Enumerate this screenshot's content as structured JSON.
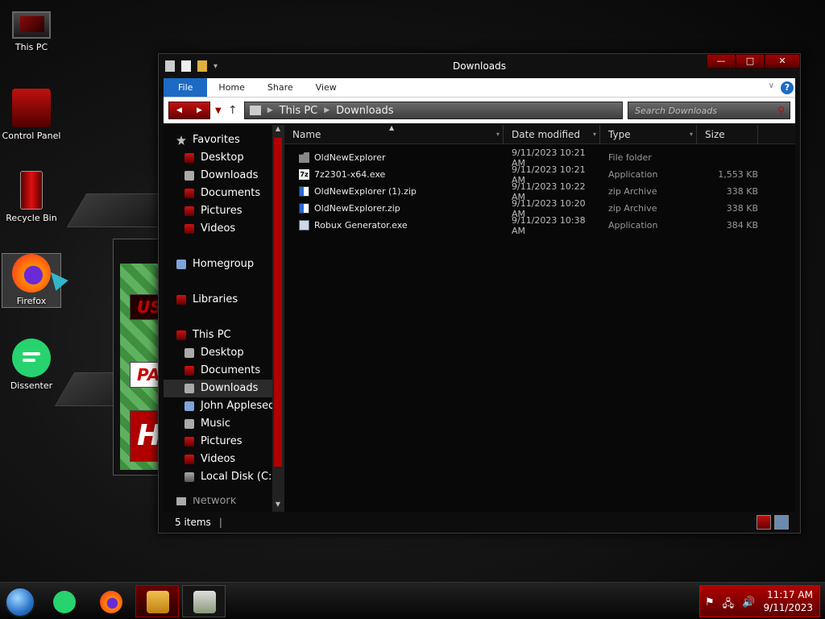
{
  "desktop": {
    "icons": [
      {
        "label": "This PC",
        "icon": "this-pc-icon"
      },
      {
        "label": "Control Panel",
        "icon": "control-panel-icon"
      },
      {
        "label": "Recycle Bin",
        "icon": "recycle-bin-icon"
      },
      {
        "label": "Firefox",
        "icon": "firefox-icon"
      },
      {
        "label": "Dissenter",
        "icon": "dissenter-icon"
      }
    ],
    "bg_window": {
      "banner1": "US",
      "banner2": "PA",
      "banner3": "H"
    }
  },
  "window": {
    "title": "Downloads",
    "buttons": {
      "minimize": "—",
      "maximize": "□",
      "close": "✕"
    }
  },
  "ribbon": {
    "tabs": [
      "File",
      "Home",
      "Share",
      "View"
    ],
    "help": "?",
    "collapse": "∨"
  },
  "navbar": {
    "back": "◀",
    "forward": "▶",
    "recent": "▼",
    "up": "↑",
    "address": [
      "This PC",
      "Downloads"
    ],
    "search_placeholder": "Search Downloads",
    "search_icon": "⚲"
  },
  "navpane": {
    "items": [
      {
        "label": "Favorites",
        "level": 0,
        "icon": "star-icon"
      },
      {
        "label": "Desktop",
        "level": 1,
        "icon": "desktop-icon"
      },
      {
        "label": "Downloads",
        "level": 1,
        "icon": "downloads-icon"
      },
      {
        "label": "Documents",
        "level": 1,
        "icon": "documents-icon"
      },
      {
        "label": "Pictures",
        "level": 1,
        "icon": "pictures-icon"
      },
      {
        "label": "Videos",
        "level": 1,
        "icon": "videos-icon"
      },
      {
        "label": "Homegroup",
        "level": 0,
        "icon": "homegroup-icon"
      },
      {
        "label": "Libraries",
        "level": 0,
        "icon": "libraries-icon"
      },
      {
        "label": "This PC",
        "level": 0,
        "icon": "this-pc-icon"
      },
      {
        "label": "Desktop",
        "level": 1,
        "icon": "desktop-icon"
      },
      {
        "label": "Documents",
        "level": 1,
        "icon": "documents-icon"
      },
      {
        "label": "Downloads",
        "level": 1,
        "icon": "downloads-icon",
        "selected": true
      },
      {
        "label": "John Applesed (",
        "level": 1,
        "icon": "user-folder-icon"
      },
      {
        "label": "Music",
        "level": 1,
        "icon": "music-icon"
      },
      {
        "label": "Pictures",
        "level": 1,
        "icon": "pictures-icon"
      },
      {
        "label": "Videos",
        "level": 1,
        "icon": "videos-icon"
      },
      {
        "label": "Local Disk (C:)",
        "level": 1,
        "icon": "drive-icon"
      },
      {
        "label": "Network",
        "level": 0,
        "icon": "network-icon"
      }
    ]
  },
  "columns": {
    "name": "Name",
    "date": "Date modified",
    "type": "Type",
    "size": "Size"
  },
  "files": [
    {
      "name": "OldNewExplorer",
      "date": "9/11/2023 10:21 AM",
      "type": "File folder",
      "size": "",
      "icon": "folder-icon"
    },
    {
      "name": "7z2301-x64.exe",
      "date": "9/11/2023 10:21 AM",
      "type": "Application",
      "size": "1,553 KB",
      "icon": "7zip-icon"
    },
    {
      "name": "OldNewExplorer (1).zip",
      "date": "9/11/2023 10:22 AM",
      "type": "zip Archive",
      "size": "338 KB",
      "icon": "zip-icon"
    },
    {
      "name": "OldNewExplorer.zip",
      "date": "9/11/2023 10:20 AM",
      "type": "zip Archive",
      "size": "338 KB",
      "icon": "zip-icon"
    },
    {
      "name": "Robux Generator.exe",
      "date": "9/11/2023 10:38 AM",
      "type": "Application",
      "size": "384 KB",
      "icon": "application-icon"
    }
  ],
  "status": {
    "count": "5 items",
    "divider": "|"
  },
  "taskbar": {
    "items": [
      "start-orb-icon",
      "dissenter-icon",
      "firefox-icon",
      "file-explorer-icon",
      "money-app-icon"
    ],
    "tray_icons": [
      "⚑",
      "🖧",
      "🔊"
    ],
    "time": "11:17 AM",
    "date": "9/11/2023"
  }
}
